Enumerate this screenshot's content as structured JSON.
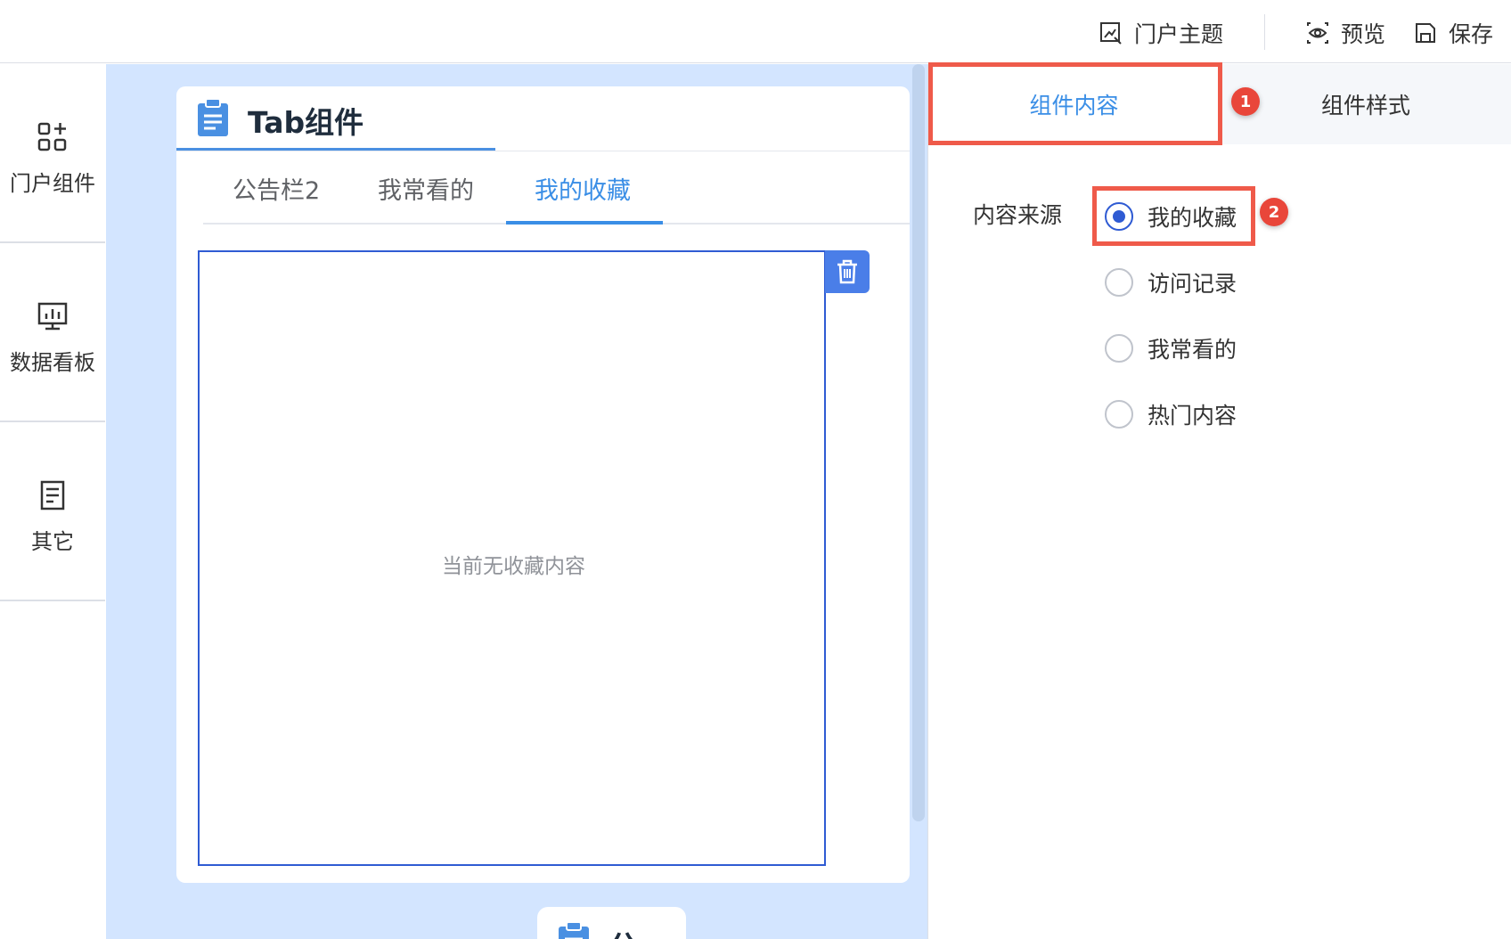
{
  "header": {
    "theme_label": "门户主题",
    "preview_label": "预览",
    "save_label": "保存"
  },
  "sidebar": {
    "items": [
      {
        "label": "门户组件",
        "icon": "grid-plus-icon"
      },
      {
        "label": "数据看板",
        "icon": "dashboard-icon"
      },
      {
        "label": "其它",
        "icon": "document-icon"
      }
    ]
  },
  "canvas": {
    "card": {
      "title": "Tab组件",
      "tabs": [
        "公告栏2",
        "我常看的",
        "我的收藏"
      ],
      "active_tab": "我的收藏",
      "empty_text": "当前无收藏内容"
    },
    "next_card": {
      "title_partial": "公"
    }
  },
  "right_panel": {
    "tabs": [
      "组件内容",
      "组件样式"
    ],
    "active_tab": "组件内容",
    "field_label": "内容来源",
    "options": [
      "我的收藏",
      "访问记录",
      "我常看的",
      "热门内容"
    ],
    "selected_option": "我的收藏",
    "badges": [
      "1",
      "2"
    ]
  },
  "colors": {
    "accent": "#3a8ee6",
    "radio_selected": "#2f5bd3",
    "highlight": "#ef5a4a",
    "canvas_bg": "#d3e5ff"
  }
}
